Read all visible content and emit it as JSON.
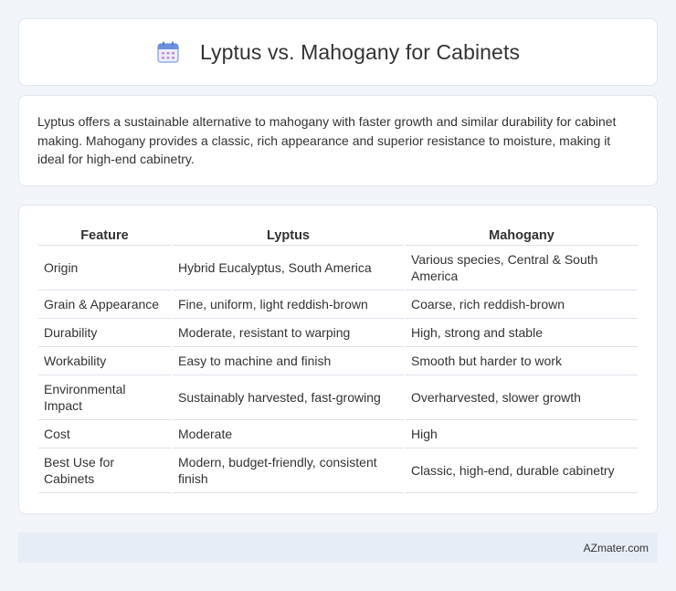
{
  "header": {
    "title": "Lyptus vs. Mahogany for Cabinets",
    "icon": "calendar-icon",
    "icon_color": "#6d8fe0"
  },
  "summary": {
    "text": "Lyptus offers a sustainable alternative to mahogany with faster growth and similar durability for cabinet making. Mahogany provides a classic, rich appearance and superior resistance to moisture, making it ideal for high-end cabinetry."
  },
  "table": {
    "headers": [
      "Feature",
      "Lyptus",
      "Mahogany"
    ],
    "rows": [
      [
        "Origin",
        "Hybrid Eucalyptus, South America",
        "Various species, Central & South America"
      ],
      [
        "Grain & Appearance",
        "Fine, uniform, light reddish-brown",
        "Coarse, rich reddish-brown"
      ],
      [
        "Durability",
        "Moderate, resistant to warping",
        "High, strong and stable"
      ],
      [
        "Workability",
        "Easy to machine and finish",
        "Smooth but harder to work"
      ],
      [
        "Environmental Impact",
        "Sustainably harvested, fast-growing",
        "Overharvested, slower growth"
      ],
      [
        "Cost",
        "Moderate",
        "High"
      ],
      [
        "Best Use for Cabinets",
        "Modern, budget-friendly, consistent finish",
        "Classic, high-end, durable cabinetry"
      ]
    ]
  },
  "footer": {
    "brand": "AZmater.com"
  }
}
